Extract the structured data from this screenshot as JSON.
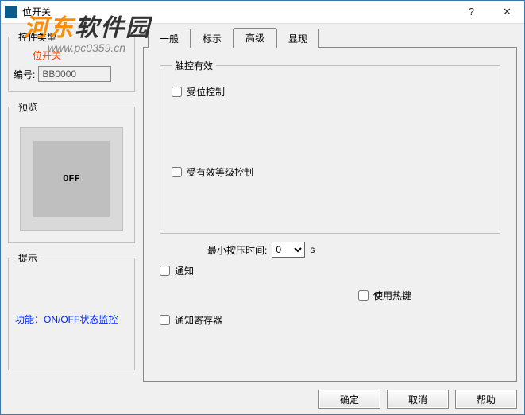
{
  "window": {
    "title": "位开关",
    "help_symbol": "?",
    "close_symbol": "✕"
  },
  "watermark": {
    "brand_prefix": "河东",
    "brand_suffix": "软件园",
    "url": "www.pc0359.cn"
  },
  "left": {
    "type_group": "控件类型",
    "type_name": "位开关",
    "num_label": "编号:",
    "num_value": "BB0000",
    "preview_group": "预览",
    "preview_text": "OFF",
    "hint_group": "提示",
    "hint_text": "功能：ON/OFF状态监控"
  },
  "tabs": {
    "t0": "一般",
    "t1": "标示",
    "t2": "高级",
    "t3": "显现"
  },
  "adv": {
    "touch_group": "触控有效",
    "chk_bit_ctrl": "受位控制",
    "chk_level_ctrl": "受有效等级控制",
    "min_press_label": "最小按压时间:",
    "min_press_value": "0",
    "min_press_unit": "s",
    "chk_notify": "通知",
    "chk_hotkey": "使用热键",
    "chk_notify_reg": "通知寄存器"
  },
  "footer": {
    "ok": "确定",
    "cancel": "取消",
    "help": "帮助"
  }
}
